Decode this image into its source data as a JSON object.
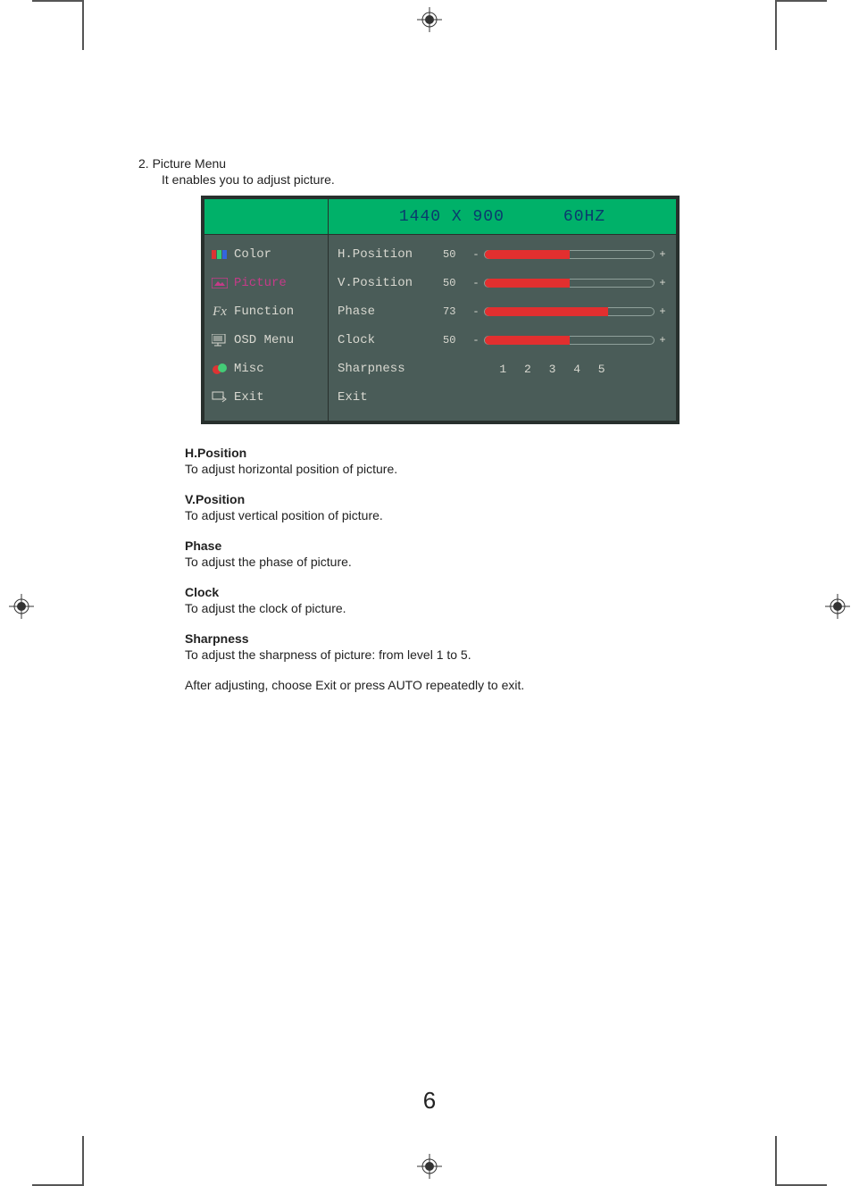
{
  "section": {
    "title": "2. Picture Menu",
    "desc": "It enables you to adjust picture."
  },
  "osd": {
    "resolution": "1440 X 900",
    "refresh": "60HZ",
    "side": {
      "color": "Color",
      "picture": "Picture",
      "function": "Function",
      "osd_menu": "OSD Menu",
      "misc": "Misc",
      "exit": "Exit"
    },
    "rows": {
      "hpos": {
        "label": "H.Position",
        "value": "50",
        "pct": 50
      },
      "vpos": {
        "label": "V.Position",
        "value": "50",
        "pct": 50
      },
      "phase": {
        "label": "Phase",
        "value": "73",
        "pct": 73
      },
      "clock": {
        "label": "Clock",
        "value": "50",
        "pct": 50
      },
      "sharpness": {
        "label": "Sharpness",
        "options": "1 2 3 4 5"
      },
      "exit": {
        "label": "Exit"
      }
    },
    "symbols": {
      "minus": "-",
      "plus": "+"
    }
  },
  "definitions": {
    "hpos": {
      "title": "H.Position",
      "desc": "To adjust horizontal position of picture."
    },
    "vpos": {
      "title": "V.Position",
      "desc": "To adjust vertical position of picture."
    },
    "phase": {
      "title": "Phase",
      "desc": "To adjust the phase of picture."
    },
    "clock": {
      "title": "Clock",
      "desc": "To adjust the clock of picture."
    },
    "sharpness": {
      "title": "Sharpness",
      "desc": "To adjust the sharpness of picture: from level 1 to 5."
    },
    "footer": "After adjusting, choose Exit or press AUTO repeatedly to exit."
  },
  "page_number": "6"
}
